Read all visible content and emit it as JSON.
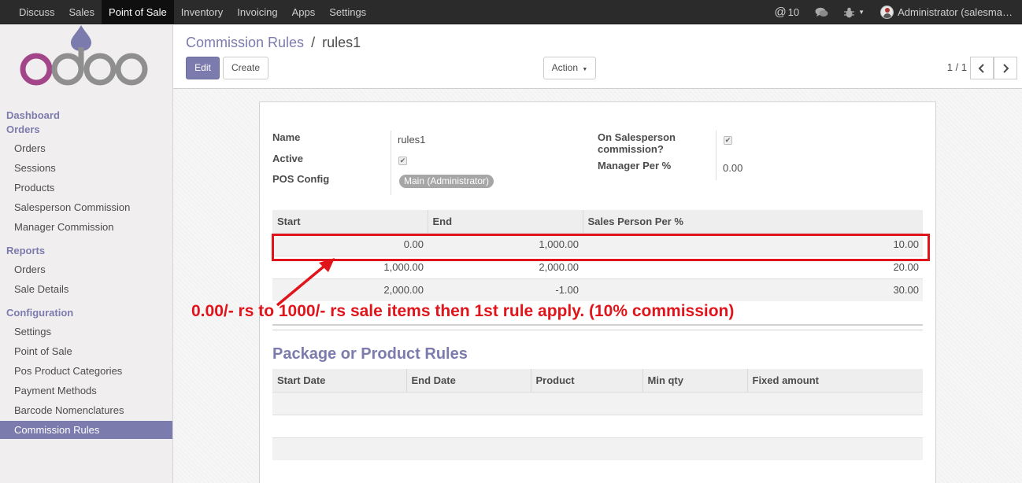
{
  "topbar": {
    "menu": [
      "Discuss",
      "Sales",
      "Point of Sale",
      "Inventory",
      "Invoicing",
      "Apps",
      "Settings"
    ],
    "active_menu": "Point of Sale",
    "mentions": "10",
    "user": "Administrator (salesma…"
  },
  "sidebar": {
    "dashboard": "Dashboard",
    "orders_section": "Orders",
    "orders_items": [
      "Orders",
      "Sessions",
      "Products",
      "Salesperson Commission",
      "Manager Commission"
    ],
    "reports_section": "Reports",
    "reports_items": [
      "Orders",
      "Sale Details"
    ],
    "config_section": "Configuration",
    "config_items": [
      "Settings",
      "Point of Sale",
      "Pos Product Categories",
      "Payment Methods",
      "Barcode Nomenclatures",
      "Commission Rules"
    ],
    "active_item": "Commission Rules"
  },
  "control_panel": {
    "breadcrumb_parent": "Commission Rules",
    "breadcrumb_sep": "/",
    "breadcrumb_current": "rules1",
    "edit_label": "Edit",
    "create_label": "Create",
    "action_label": "Action",
    "pager": "1 / 1"
  },
  "form": {
    "name_label": "Name",
    "name_value": "rules1",
    "active_label": "Active",
    "active_checked": true,
    "pos_config_label": "POS Config",
    "pos_config_value": "Main (Administrator)",
    "on_salesperson_label_1": "On Salesperson",
    "on_salesperson_label_2": "commission?",
    "on_salesperson_checked": true,
    "manager_per_label": "Manager Per %",
    "manager_per_value": "0.00"
  },
  "rules_table": {
    "headers": [
      "Start",
      "End",
      "Sales Person Per %"
    ],
    "rows": [
      [
        "0.00",
        "1,000.00",
        "10.00"
      ],
      [
        "1,000.00",
        "2,000.00",
        "20.00"
      ],
      [
        "2,000.00",
        "-1.00",
        "30.00"
      ]
    ]
  },
  "package_section": {
    "title": "Package or Product Rules",
    "headers": [
      "Start Date",
      "End Date",
      "Product",
      "Min qty",
      "Fixed amount"
    ]
  },
  "annotation": {
    "text": "0.00/- rs to 1000/- rs sale items then 1st rule apply. (10% commission)",
    "color": "#e0141a"
  },
  "colors": {
    "brand": "#7c7bad",
    "topbar": "#2b2b2b",
    "logo_o1": "#a24689",
    "logo_grey": "#8f8f8f",
    "logo_drop": "#7c7bad"
  }
}
